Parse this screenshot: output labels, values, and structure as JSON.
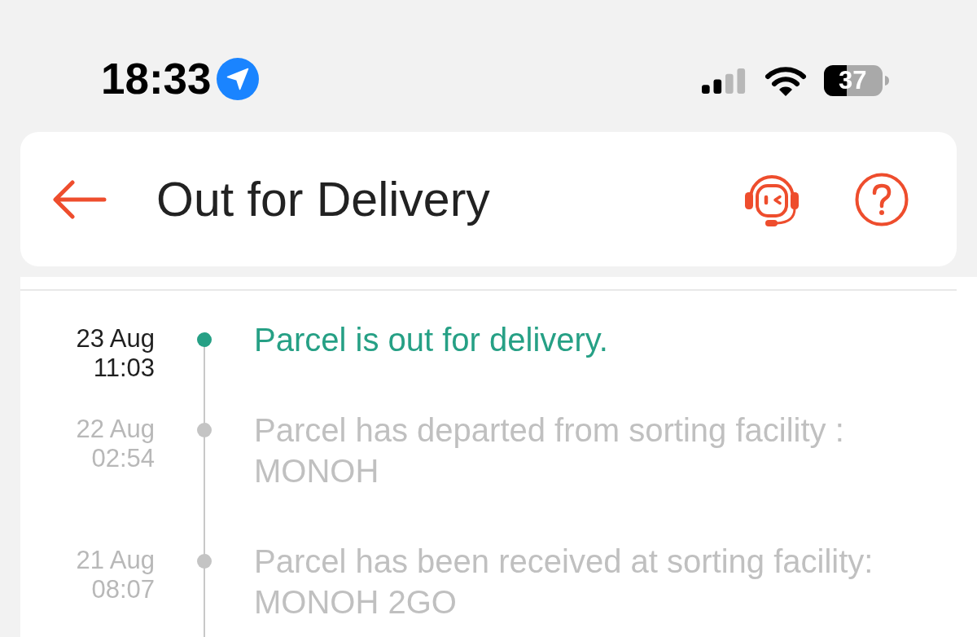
{
  "status_bar": {
    "time": "18:33",
    "battery": "37"
  },
  "header": {
    "title": "Out for Delivery"
  },
  "timeline": [
    {
      "date": "23 Aug",
      "time": "11:03",
      "description": "Parcel is out for delivery.",
      "active": true
    },
    {
      "date": "22 Aug",
      "time": "02:54",
      "description": "Parcel has departed from sorting facility : MONOH",
      "active": false
    },
    {
      "date": "21 Aug",
      "time": "08:07",
      "description": "Parcel has been received at sorting facility: MONOH 2GO",
      "active": false
    }
  ]
}
